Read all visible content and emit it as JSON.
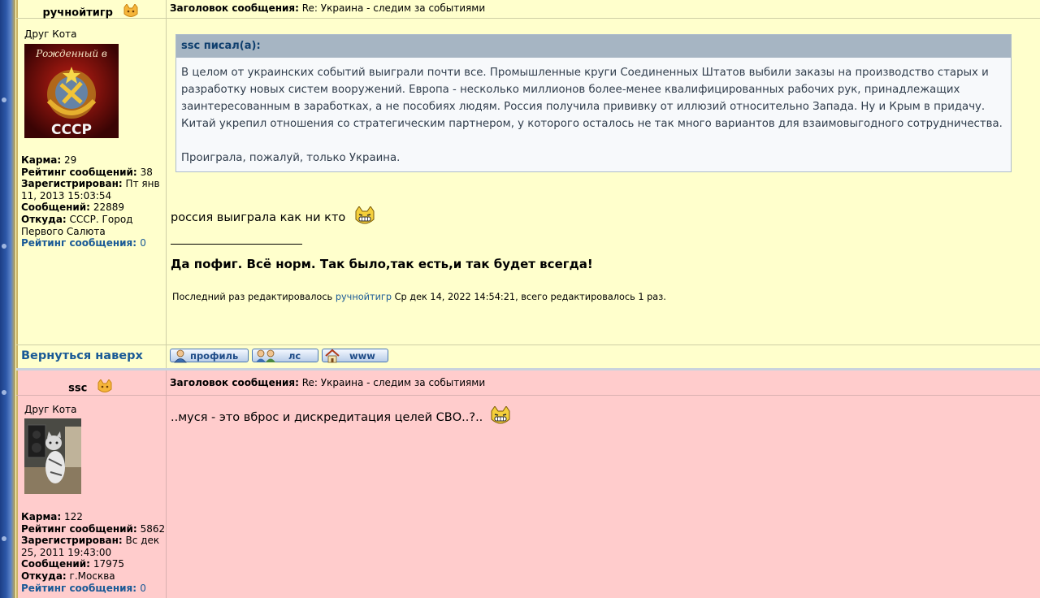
{
  "posts": [
    {
      "author": "ручнойтигр",
      "subject_label": "Заголовок сообщения:",
      "subject": "Re: Украина - следим за событиями",
      "rank": "Друг Кота",
      "avatar_text": [
        "Рожденный в",
        "СССР"
      ],
      "stats": {
        "karma_label": "Карма:",
        "karma": "29",
        "rating_label": "Рейтинг сообщений:",
        "rating": "38",
        "registered_label": "Зарегистрирован:",
        "registered": "Пт янв 11, 2013 15:03:54",
        "posts_label": "Сообщений:",
        "posts": "22889",
        "from_label": "Откуда:",
        "from": "СССР. Город Первого Салюта",
        "post_rating_label": "Рейтинг сообщения:",
        "post_rating": "0"
      },
      "quote": {
        "header": "ssc писал(а):",
        "paragraph1": "В целом от украинских событий выиграли почти все. Промышленные круги Соединенных Штатов выбили заказы на производство старых и разработку новых систем вооружений. Европа - несколько миллионов более-менее квалифицированных рабочих рук, принадлежащих заинтересованным в заработках, а не пособиях людям. Россия получила прививку от иллюзий относительно Запада. Ну и Крым в придачу. Китай укрепил отношения со стратегическим партнером, у которого осталось не так много вариантов для взаимовыгодного сотрудничества.",
        "paragraph2": "Проиграла, пожалуй, только Украина."
      },
      "message": "россия выиграла как ни кто",
      "signature_line": "_________________",
      "signature": "Да пофиг. Всё норм. Так было,так есть,и так будет всегда!",
      "edited": {
        "prefix": "Последний раз редактировалось",
        "editor": "ручнойтигр",
        "suffix": "Ср дек 14, 2022 14:54:21, всего редактировалось 1 раз."
      },
      "back_to_top": "Вернуться наверх",
      "buttons": {
        "profile": "профиль",
        "pm": "лс",
        "www": "www"
      }
    },
    {
      "author": "ssc",
      "subject_label": "Заголовок сообщения:",
      "subject": "Re: Украина - следим за событиями",
      "rank": "Друг Кота",
      "stats": {
        "karma_label": "Карма:",
        "karma": "122",
        "rating_label": "Рейтинг сообщений:",
        "rating": "5862",
        "registered_label": "Зарегистрирован:",
        "registered": "Вс дек 25, 2011 19:43:00",
        "posts_label": "Сообщений:",
        "posts": "17975",
        "from_label": "Откуда:",
        "from": "г.Москва",
        "post_rating_label": "Рейтинг сообщения:",
        "post_rating": "0"
      },
      "message": "..муся - это вброс и дискредитация целей СВО..?.."
    }
  ],
  "colors": {
    "post_bg_1": "#ffffcc",
    "post_bg_2": "#ffcccc",
    "link_blue": "#1a5a96",
    "quote_header_bg": "#a6b5c3",
    "quote_bg": "#f7f9fb"
  },
  "icons": [
    "cat-rank-icon",
    "grinning-cat-emoticon",
    "profile-icon",
    "pm-icon",
    "home-icon"
  ]
}
